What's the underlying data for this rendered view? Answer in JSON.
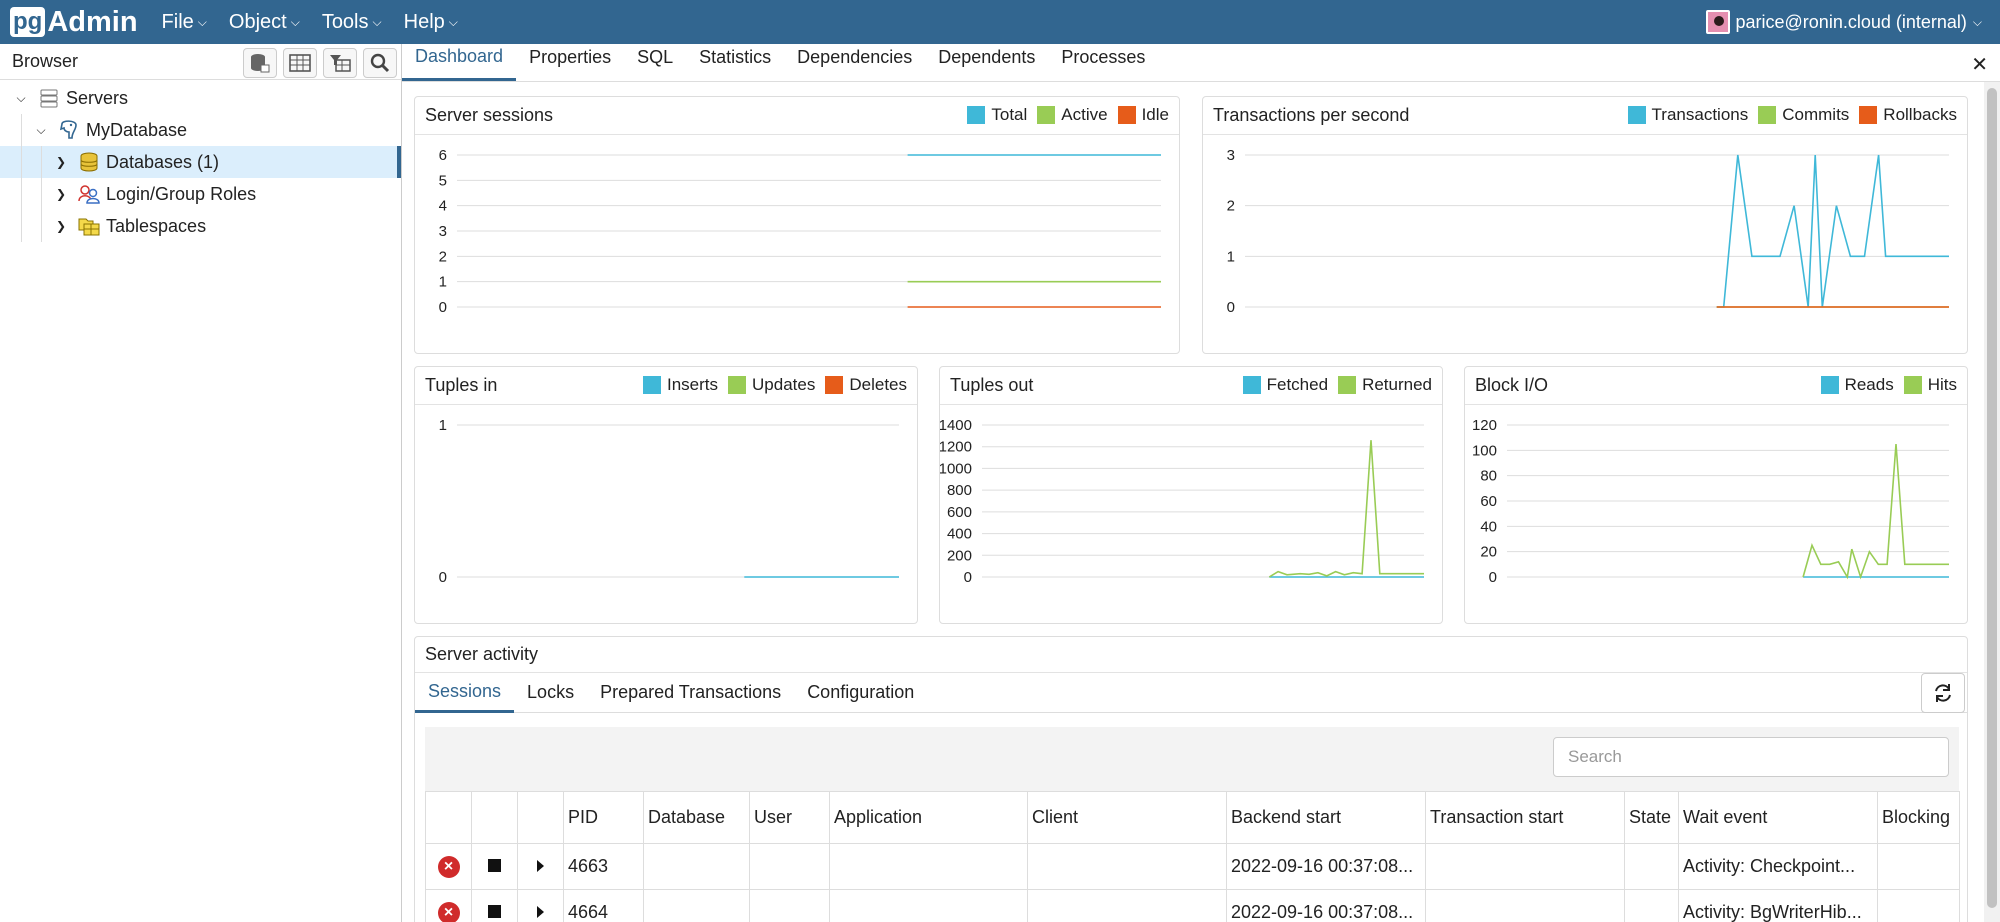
{
  "app": {
    "logo_pg": "pg",
    "logo_admin": "Admin",
    "menu": [
      {
        "label": "File"
      },
      {
        "label": "Object"
      },
      {
        "label": "Tools"
      },
      {
        "label": "Help"
      }
    ],
    "user": "parice@ronin.cloud (internal)"
  },
  "browser": {
    "title": "Browser",
    "tools": [
      "query-tool-icon",
      "view-data-icon",
      "filtered-rows-icon",
      "search-objects-icon"
    ],
    "tree": [
      {
        "label": "Servers",
        "icon": "servers-icon",
        "level": 0,
        "expanded": true
      },
      {
        "label": "MyDatabase",
        "icon": "postgres-elephant-icon",
        "level": 1,
        "expanded": true
      },
      {
        "label": "Databases (1)",
        "icon": "databases-icon",
        "level": 2,
        "expanded": false,
        "selected": true
      },
      {
        "label": "Login/Group Roles",
        "icon": "roles-icon",
        "level": 2,
        "expanded": false
      },
      {
        "label": "Tablespaces",
        "icon": "tablespaces-icon",
        "level": 2,
        "expanded": false
      }
    ]
  },
  "tabs": [
    {
      "label": "Dashboard",
      "active": true
    },
    {
      "label": "Properties"
    },
    {
      "label": "SQL"
    },
    {
      "label": "Statistics"
    },
    {
      "label": "Dependencies"
    },
    {
      "label": "Dependents"
    },
    {
      "label": "Processes"
    }
  ],
  "colors": {
    "blue": "#3fb8d8",
    "green": "#99cc55",
    "orange": "#e65c1a",
    "accent": "#326690"
  },
  "chart_data": [
    {
      "type": "line",
      "title": "Server sessions",
      "ylim": [
        0,
        6
      ],
      "yticks": [
        "0",
        "1",
        "2",
        "3",
        "4",
        "5",
        "6"
      ],
      "series": [
        {
          "name": "Total",
          "color": "#3fb8d8",
          "x": [
            0.64,
            1
          ],
          "values": [
            6,
            6
          ]
        },
        {
          "name": "Active",
          "color": "#99cc55",
          "x": [
            0.64,
            1
          ],
          "values": [
            1,
            1
          ]
        },
        {
          "name": "Idle",
          "color": "#e65c1a",
          "x": [
            0.64,
            1
          ],
          "values": [
            0,
            0
          ]
        }
      ]
    },
    {
      "type": "line",
      "title": "Transactions per second",
      "ylim": [
        0,
        3
      ],
      "yticks": [
        "0",
        "1",
        "2",
        "3"
      ],
      "series": [
        {
          "name": "Transactions",
          "color": "#3fb8d8",
          "x": [
            0.67,
            0.68,
            0.7,
            0.72,
            0.76,
            0.78,
            0.8,
            0.81,
            0.82,
            0.84,
            0.86,
            0.88,
            0.9,
            0.91,
            0.93,
            1
          ],
          "values": [
            0,
            0,
            3,
            1,
            1,
            2,
            0,
            3,
            0,
            2,
            1,
            1,
            3,
            1,
            1,
            1
          ]
        },
        {
          "name": "Commits",
          "color": "#99cc55",
          "x": [
            0.67,
            1
          ],
          "values": [
            0,
            0
          ]
        },
        {
          "name": "Rollbacks",
          "color": "#e65c1a",
          "x": [
            0.67,
            1
          ],
          "values": [
            0,
            0
          ]
        }
      ]
    },
    {
      "type": "line",
      "title": "Tuples in",
      "ylim": [
        0,
        1
      ],
      "yticks": [
        "0",
        "1"
      ],
      "series": [
        {
          "name": "Inserts",
          "color": "#3fb8d8",
          "x": [
            0.65,
            1
          ],
          "values": [
            0,
            0
          ]
        },
        {
          "name": "Updates",
          "color": "#99cc55",
          "x": [],
          "values": []
        },
        {
          "name": "Deletes",
          "color": "#e65c1a",
          "x": [],
          "values": []
        }
      ]
    },
    {
      "type": "line",
      "title": "Tuples out",
      "ylim": [
        0,
        1400
      ],
      "yticks": [
        "0",
        "200",
        "400",
        "600",
        "800",
        "1000",
        "1200",
        "1400"
      ],
      "series": [
        {
          "name": "Fetched",
          "color": "#3fb8d8",
          "x": [
            0.65,
            1
          ],
          "values": [
            0,
            0
          ]
        },
        {
          "name": "Returned",
          "color": "#99cc55",
          "x": [
            0.65,
            0.67,
            0.69,
            0.72,
            0.74,
            0.76,
            0.78,
            0.8,
            0.82,
            0.84,
            0.86,
            0.88,
            0.9,
            0.92,
            1
          ],
          "values": [
            0,
            50,
            20,
            30,
            25,
            40,
            10,
            50,
            20,
            40,
            30,
            1260,
            30,
            30,
            30
          ]
        }
      ]
    },
    {
      "type": "line",
      "title": "Block I/O",
      "ylim": [
        0,
        120
      ],
      "yticks": [
        "0",
        "20",
        "40",
        "60",
        "80",
        "100",
        "120"
      ],
      "series": [
        {
          "name": "Reads",
          "color": "#3fb8d8",
          "x": [
            0.67,
            1
          ],
          "values": [
            0,
            0
          ]
        },
        {
          "name": "Hits",
          "color": "#99cc55",
          "x": [
            0.67,
            0.69,
            0.71,
            0.73,
            0.75,
            0.77,
            0.78,
            0.8,
            0.82,
            0.84,
            0.86,
            0.88,
            0.9,
            0.92,
            1
          ],
          "values": [
            0,
            25,
            10,
            10,
            12,
            0,
            22,
            0,
            20,
            10,
            10,
            105,
            10,
            10,
            10
          ]
        }
      ]
    }
  ],
  "activity": {
    "title": "Server activity",
    "tabs": [
      {
        "label": "Sessions",
        "active": true
      },
      {
        "label": "Locks"
      },
      {
        "label": "Prepared Transactions"
      },
      {
        "label": "Configuration"
      }
    ],
    "search_placeholder": "Search",
    "columns": [
      "",
      "",
      "",
      "PID",
      "Database",
      "User",
      "Application",
      "Client",
      "Backend start",
      "Transaction start",
      "State",
      "Wait event",
      "Blocking"
    ],
    "rows": [
      {
        "pid": "4663",
        "database": "",
        "user": "",
        "application": "",
        "client": "",
        "backend_start": "2022-09-16 00:37:08...",
        "transaction_start": "",
        "state": "",
        "wait_event": "Activity: Checkpoint...",
        "blocking": ""
      },
      {
        "pid": "4664",
        "database": "",
        "user": "",
        "application": "",
        "client": "",
        "backend_start": "2022-09-16 00:37:08...",
        "transaction_start": "",
        "state": "",
        "wait_event": "Activity: BgWriterHib...",
        "blocking": ""
      }
    ]
  }
}
